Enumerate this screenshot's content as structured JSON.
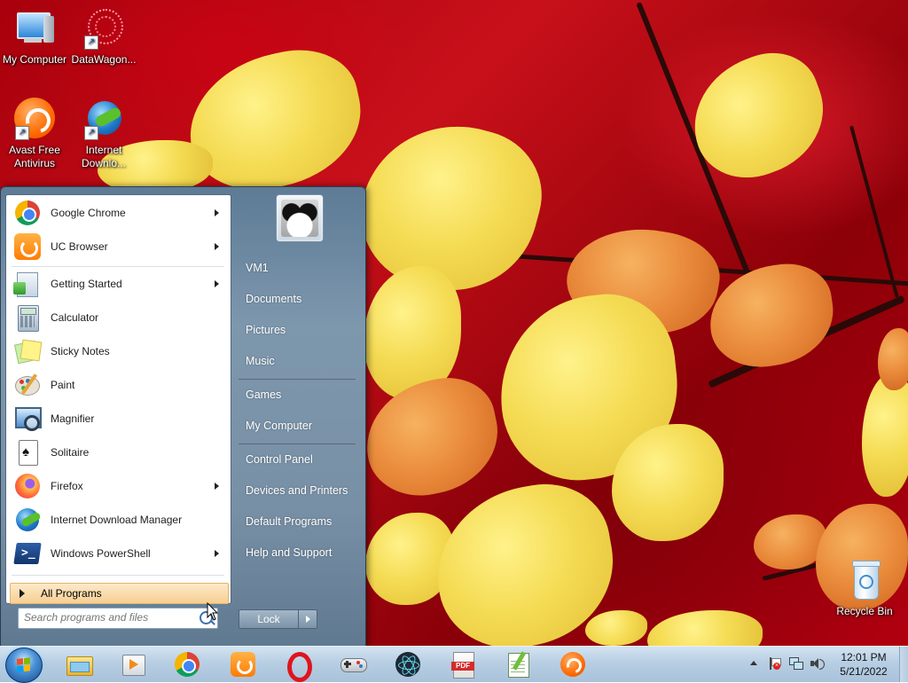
{
  "desktop": {
    "icons": [
      {
        "label": "My Computer"
      },
      {
        "label": "DataWagon..."
      },
      {
        "label": "Avast Free Antivirus"
      },
      {
        "label": "Internet Downlo..."
      },
      {
        "label": "Recycle Bin"
      }
    ]
  },
  "start_menu": {
    "pinned": [
      {
        "label": "Google Chrome",
        "has_submenu": true,
        "icon": "chrome-icon"
      },
      {
        "label": "UC Browser",
        "has_submenu": true,
        "icon": "uc-browser-icon"
      }
    ],
    "recent": [
      {
        "label": "Getting Started",
        "has_submenu": true,
        "icon": "getting-started-icon"
      },
      {
        "label": "Calculator",
        "has_submenu": false,
        "icon": "calculator-icon"
      },
      {
        "label": "Sticky Notes",
        "has_submenu": false,
        "icon": "sticky-notes-icon"
      },
      {
        "label": "Paint",
        "has_submenu": false,
        "icon": "paint-icon"
      },
      {
        "label": "Magnifier",
        "has_submenu": false,
        "icon": "magnifier-icon"
      },
      {
        "label": "Solitaire",
        "has_submenu": false,
        "icon": "solitaire-icon"
      },
      {
        "label": "Firefox",
        "has_submenu": true,
        "icon": "firefox-icon"
      },
      {
        "label": "Internet Download Manager",
        "has_submenu": false,
        "icon": "idm-icon"
      },
      {
        "label": "Windows PowerShell",
        "has_submenu": true,
        "icon": "powershell-icon"
      }
    ],
    "all_programs": "All Programs",
    "search_placeholder": "Search programs and files",
    "right": {
      "group1": [
        "VM1",
        "Documents",
        "Pictures",
        "Music"
      ],
      "group2": [
        "Games",
        "My Computer"
      ],
      "group3": [
        "Control Panel",
        "Devices and Printers",
        "Default Programs",
        "Help and Support"
      ]
    },
    "lock_label": "Lock"
  },
  "taskbar": {
    "pinned": [
      "explorer-icon",
      "media-player-icon",
      "chrome-icon",
      "uc-browser-icon",
      "opera-icon",
      "game-controller-icon",
      "atom-icon",
      "pdf-icon",
      "notepad-plus-plus-icon",
      "avast-icon"
    ],
    "clock": {
      "time": "12:01 PM",
      "date": "5/21/2022"
    }
  }
}
